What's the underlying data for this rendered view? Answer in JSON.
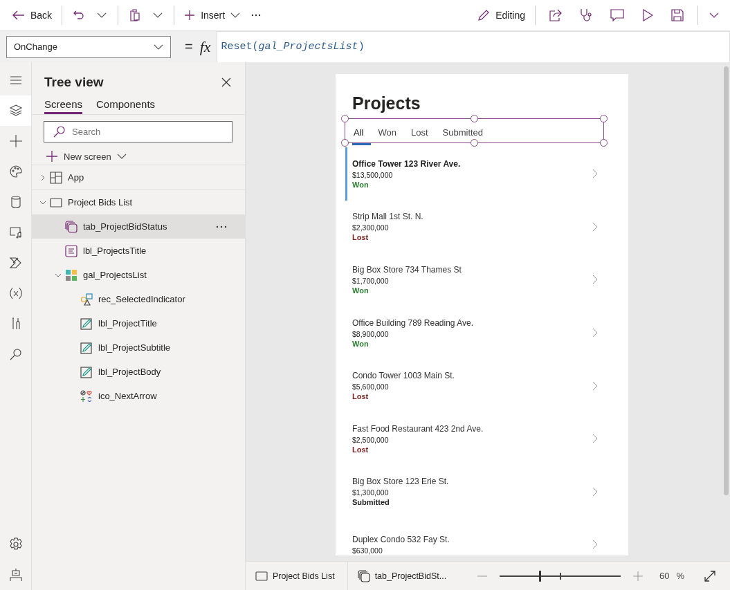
{
  "toolbar": {
    "back": "Back",
    "insert": "Insert",
    "mode": "Editing"
  },
  "formula_bar": {
    "property": "OnChange",
    "equals": "=",
    "fx": "fx",
    "expression": "Reset(*gal_ProjectsList*)"
  },
  "rail": [
    {
      "kind": "menu",
      "selected": false
    },
    {
      "kind": "layers",
      "selected": true
    },
    {
      "kind": "plus",
      "selected": false
    },
    {
      "kind": "palette",
      "selected": false
    },
    {
      "kind": "database",
      "selected": false
    },
    {
      "kind": "media",
      "selected": false
    },
    {
      "kind": "automate",
      "selected": false
    },
    {
      "kind": "variables",
      "selected": false
    },
    {
      "kind": "tools",
      "selected": false
    },
    {
      "kind": "search",
      "selected": false
    }
  ],
  "rail_bottom": [
    {
      "kind": "settings",
      "selected": false
    },
    {
      "kind": "bot",
      "selected": false
    }
  ],
  "tree_view": {
    "title": "Tree view",
    "tabs": [
      {
        "label": "Screens",
        "selected": true
      },
      {
        "label": "Components",
        "selected": false
      }
    ],
    "search": {
      "placeholder": "Search"
    },
    "new_screen": "New screen",
    "items": [
      {
        "label": "App",
        "kind": "app",
        "selected": false,
        "expanded": false
      },
      {
        "label": "Project Bids List",
        "kind": "screen",
        "selected": false,
        "expanded": true,
        "children": [
          {
            "label": "tab_ProjectBidStatus",
            "kind": "tabs",
            "selected": true
          },
          {
            "label": "lbl_ProjectsTitle",
            "kind": "label",
            "selected": false
          },
          {
            "label": "gal_ProjectsList",
            "kind": "gallery",
            "selected": false,
            "expanded": true,
            "children": [
              {
                "label": "rec_SelectedIndicator",
                "kind": "shapes",
                "selected": false
              },
              {
                "label": "lbl_ProjectTitle",
                "kind": "edit-label",
                "selected": false
              },
              {
                "label": "lbl_ProjectSubtitle",
                "kind": "edit-label",
                "selected": false
              },
              {
                "label": "lbl_ProjectBody",
                "kind": "edit-label",
                "selected": false
              },
              {
                "label": "ico_NextArrow",
                "kind": "icons",
                "selected": false
              }
            ]
          }
        ]
      }
    ]
  },
  "canvas": {
    "title": "Projects",
    "tabs": [
      {
        "label": "All",
        "selected": true
      },
      {
        "label": "Won",
        "selected": false
      },
      {
        "label": "Lost",
        "selected": false
      },
      {
        "label": "Submitted",
        "selected": false
      }
    ],
    "gallery": [
      {
        "title": "Office Tower 123 River Ave.",
        "amount": "$13,500,000",
        "status": "Won",
        "color": "#2e7d32",
        "selected": true
      },
      {
        "title": "Strip Mall 1st St. N.",
        "amount": "$2,300,000",
        "status": "Lost",
        "color": "#7a1f1f",
        "selected": false
      },
      {
        "title": "Big Box Store 734 Thames St",
        "amount": "$1,700,000",
        "status": "Won",
        "color": "#2e7d32",
        "selected": false
      },
      {
        "title": "Office Building 789 Reading Ave.",
        "amount": "$8,900,000",
        "status": "Won",
        "color": "#2e7d32",
        "selected": false
      },
      {
        "title": "Condo Tower 1003 Main St.",
        "amount": "$5,600,000",
        "status": "Lost",
        "color": "#7a1f1f",
        "selected": false
      },
      {
        "title": "Fast Food Restaurant 423 2nd Ave.",
        "amount": "$2,500,000",
        "status": "Lost",
        "color": "#7a1f1f",
        "selected": false
      },
      {
        "title": "Big Box Store 123 Erie St.",
        "amount": "$1,300,000",
        "status": "Submitted",
        "color": "#222222",
        "selected": false
      },
      {
        "title": "Duplex Condo 532 Fay St.",
        "amount": "$630,000",
        "selected": false
      }
    ]
  },
  "status_bar": {
    "breadcrumbs": [
      {
        "label": "Project Bids List",
        "kind": "screen"
      },
      {
        "label": "tab_ProjectBidSt...",
        "kind": "tabs"
      }
    ],
    "zoom": {
      "level": 0.33,
      "value": "60",
      "unit": "%"
    }
  }
}
